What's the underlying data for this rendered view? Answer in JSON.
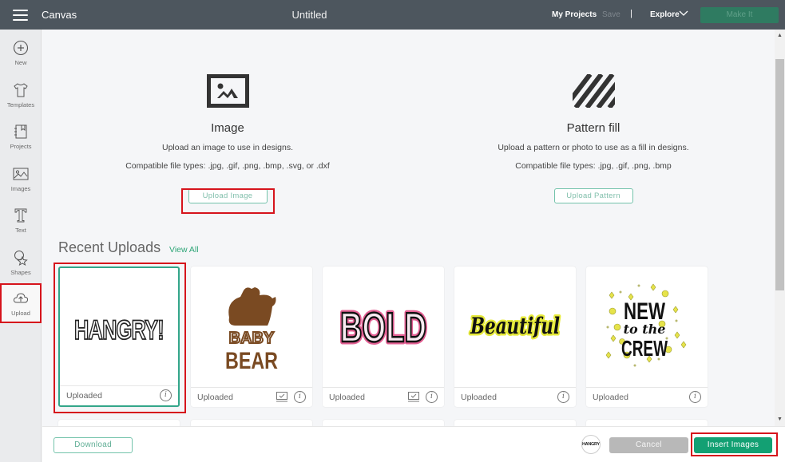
{
  "topbar": {
    "app_title": "Canvas",
    "doc_title": "Untitled",
    "my_projects": "My Projects",
    "save": "Save",
    "separator": "|",
    "explore": "Explore",
    "make_it": "Make It"
  },
  "sidebar": {
    "items": [
      {
        "label": "New",
        "icon": "plus-circle-icon"
      },
      {
        "label": "Templates",
        "icon": "shirt-icon"
      },
      {
        "label": "Projects",
        "icon": "notebook-icon"
      },
      {
        "label": "Images",
        "icon": "image-icon"
      },
      {
        "label": "Text",
        "icon": "text-t-icon"
      },
      {
        "label": "Shapes",
        "icon": "shapes-icon"
      },
      {
        "label": "Upload",
        "icon": "cloud-upload-icon",
        "active": true
      }
    ]
  },
  "upload_image": {
    "title": "Image",
    "description": "Upload an image to use in designs.",
    "types": "Compatible file types: .jpg, .gif, .png, .bmp, .svg, or .dxf",
    "button": "Upload Image"
  },
  "upload_pattern": {
    "title": "Pattern fill",
    "description": "Upload a pattern or photo to use as a fill in designs.",
    "types": "Compatible file types: .jpg, .gif, .png, .bmp",
    "button": "Upload Pattern"
  },
  "recent": {
    "title": "Recent Uploads",
    "view_all": "View All",
    "items": [
      {
        "name": "HANGRY!",
        "status": "Uploaded",
        "selected": true,
        "cut_icon": false
      },
      {
        "name": "BABY BEAR",
        "status": "Uploaded",
        "selected": false,
        "cut_icon": true
      },
      {
        "name": "BOLD",
        "status": "Uploaded",
        "selected": false,
        "cut_icon": true
      },
      {
        "name": "Beautiful",
        "status": "Uploaded",
        "selected": false,
        "cut_icon": false
      },
      {
        "name": "NEW to the CREW",
        "status": "Uploaded",
        "selected": false,
        "cut_icon": false
      }
    ]
  },
  "bottombar": {
    "download": "Download",
    "preview_label": "HANGRY!",
    "cancel": "Cancel",
    "insert": "Insert Images"
  },
  "colors": {
    "header_bg": "#4d565e",
    "accent_green": "#13a073",
    "highlight_red": "#d6141c"
  }
}
